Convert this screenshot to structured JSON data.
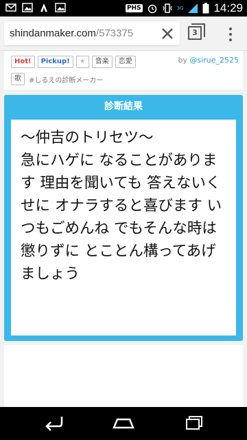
{
  "status": {
    "carrier_badge": "PHS",
    "network": "3G",
    "time": "14:29"
  },
  "browser": {
    "url_domain": "shindanmaker.com",
    "url_path": "/573375",
    "tab_count": "3"
  },
  "page": {
    "tags": {
      "hot": "Hot!",
      "pickup": "Pickup!",
      "star": "★",
      "music": "音楽",
      "romance": "恋愛",
      "song": "歌"
    },
    "hashtag": "#しるえの診断メーカー",
    "byline_prefix": "by ",
    "author": "@sirue_2525",
    "result_header": "診断結果",
    "result_text": "〜仲吉のトリセツ〜\n急にハゲに なることがあります 理由を聞いても 答えないくせに オナラすると喜びます いつもごめんね でもそんな時は 懲りずに とことん構ってあげましょう"
  }
}
